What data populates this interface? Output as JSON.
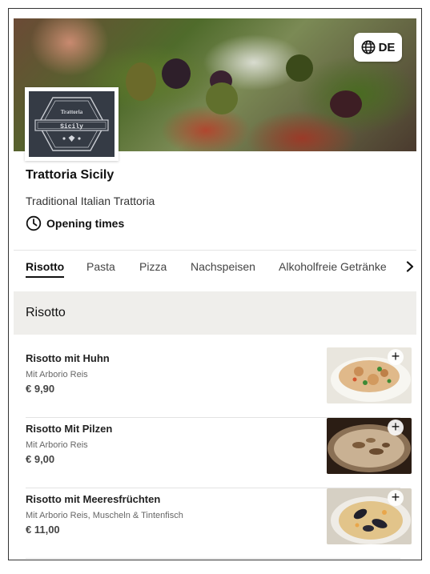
{
  "header": {
    "language_label": "DE",
    "language_icon": "globe-icon"
  },
  "logo": {
    "top_text": "Trattoria",
    "main_text": "Sicily"
  },
  "restaurant": {
    "name": "Trattoria Sicily",
    "subtitle": "Traditional Italian Trattoria",
    "opening_label": "Opening times",
    "opening_icon": "clock-icon"
  },
  "tabs": [
    {
      "label": "Risotto",
      "active": true
    },
    {
      "label": "Pasta",
      "active": false
    },
    {
      "label": "Pizza",
      "active": false
    },
    {
      "label": "Nachspeisen",
      "active": false
    },
    {
      "label": "Alkoholfreie Getränke",
      "active": false
    }
  ],
  "section": {
    "title": "Risotto"
  },
  "items": [
    {
      "name": "Risotto mit Huhn",
      "description": "Mit Arborio Reis",
      "price": "€ 9,90"
    },
    {
      "name": "Risotto Mit Pilzen",
      "description": "Mit Arborio Reis",
      "price": "€ 9,00"
    },
    {
      "name": "Risotto mit Meeresfrüchten",
      "description": "Mit Arborio Reis, Muscheln & Tintenfisch",
      "price": "€ 11,00"
    }
  ],
  "colors": {
    "section_bg": "#efeeeb",
    "logo_bg": "#353b45"
  }
}
